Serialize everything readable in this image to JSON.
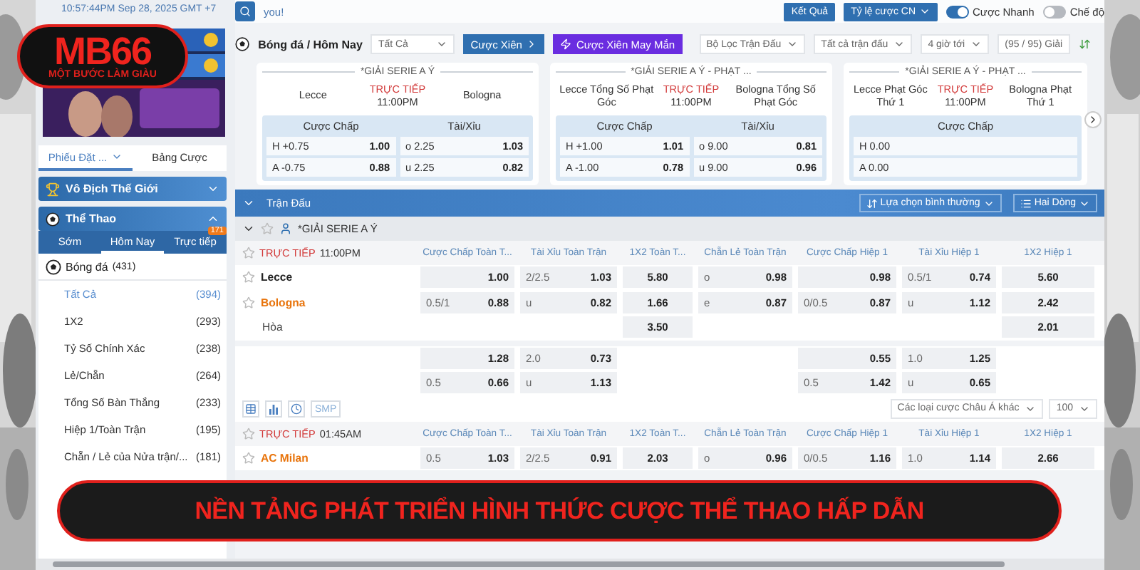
{
  "overlay": {
    "logo": {
      "title": "MB66",
      "slogan": "MỘT BƯỚC LÀM GIÀU"
    },
    "banner": "NỀN TẢNG PHÁT TRIỂN HÌNH THỨC CƯỢC THỂ THAO HẤP DẪN"
  },
  "top_bar": {
    "clock": "10:57:44PM Sep 28, 2025 GMT +7",
    "search_value": "you!",
    "buttons": [
      {
        "label": "Kết Quả",
        "kind": "button"
      },
      {
        "label": "Tỷ lệ cược CN",
        "kind": "dropdown"
      }
    ],
    "toggles": [
      {
        "label": "Cược Nhanh",
        "on": true
      },
      {
        "label": "Chế độ",
        "on": false
      }
    ]
  },
  "sidebar": {
    "tabs": [
      {
        "label": "Phiếu Đặt ...",
        "selected": true
      },
      {
        "label": "Bảng Cược",
        "selected": false
      }
    ],
    "sections": [
      {
        "title": "Vô Địch Thế Giới",
        "kind": "trophy",
        "expanded": false
      },
      {
        "title": "Thể Thao",
        "kind": "sports",
        "expanded": true
      }
    ],
    "sport_tabs": [
      {
        "label": "Sớm",
        "selected": false
      },
      {
        "label": "Hôm Nay",
        "selected": true
      },
      {
        "label": "Trực tiếp",
        "selected": false,
        "badge": "171"
      }
    ],
    "sport": {
      "label": "Bóng đá",
      "count": "(431)"
    },
    "markets": [
      {
        "label": "Tất Cả",
        "count": "(394)",
        "selected": true
      },
      {
        "label": "1X2",
        "count": "(293)",
        "selected": false
      },
      {
        "label": "Tỷ Số Chính Xác",
        "count": "(238)",
        "selected": false
      },
      {
        "label": "Lẻ/Chẵn",
        "count": "(264)",
        "selected": false
      },
      {
        "label": "Tổng Số Bàn Thắng",
        "count": "(233)",
        "selected": false
      },
      {
        "label": "Hiệp 1/Toàn Trận",
        "count": "(195)",
        "selected": false
      },
      {
        "label": "Chẵn / Lẻ của Nửa trận/...",
        "count": "(181)",
        "selected": false
      }
    ]
  },
  "filter_bar": {
    "breadcrumb": "Bóng đá / Hôm Nay",
    "select": "Tất Cả",
    "buttons": [
      {
        "label": "Cược Xiên",
        "kind": "parlay"
      },
      {
        "label": "Cược Xiên May Mắn",
        "kind": "lucky"
      }
    ],
    "filters": [
      {
        "label": "Bộ Lọc Trận Đấu",
        "kind": "dropdown"
      },
      {
        "label": "Tất cả trận đấu",
        "kind": "dropdown"
      },
      {
        "label": "4 giờ tới",
        "kind": "dropdown"
      },
      {
        "label": "(95 / 95) Giải",
        "kind": "text"
      }
    ]
  },
  "featured": [
    {
      "league": "*GIẢI SERIE A Ý",
      "home": "Lecce",
      "status": "TRỰC TIẾP",
      "time": "11:00PM",
      "away": "Bologna",
      "markets": [
        {
          "title": "Cược Chấp",
          "rows": [
            {
              "label": "H +0.75",
              "odds": "1.00"
            },
            {
              "label": "A -0.75",
              "odds": "0.88"
            }
          ]
        },
        {
          "title": "Tài/Xỉu",
          "rows": [
            {
              "label": "o 2.25",
              "odds": "1.03"
            },
            {
              "label": "u 2.25",
              "odds": "0.82"
            }
          ]
        }
      ]
    },
    {
      "league": "*GIẢI SERIE A Ý - PHẠT ...",
      "home": "Lecce Tổng Số Phạt Góc",
      "status": "TRỰC TIẾP",
      "time": "11:00PM",
      "away": "Bologna Tổng Số Phạt Góc",
      "markets": [
        {
          "title": "Cược Chấp",
          "rows": [
            {
              "label": "H +1.00",
              "odds": "1.01"
            },
            {
              "label": "A -1.00",
              "odds": "0.78"
            }
          ]
        },
        {
          "title": "Tài/Xỉu",
          "rows": [
            {
              "label": "o 9.00",
              "odds": "0.81"
            },
            {
              "label": "u 9.00",
              "odds": "0.96"
            }
          ]
        }
      ]
    },
    {
      "league": "*GIẢI SERIE A Ý - PHẠT ...",
      "home": "Lecce Phạt Góc Thứ 1",
      "status": "TRỰC TIẾP",
      "time": "11:00PM",
      "away": "Bologna Phạt Thứ 1",
      "markets": [
        {
          "title": "Cược Chấp",
          "rows": [
            {
              "label": "H 0.00"
            },
            {
              "label": "A 0.00"
            }
          ]
        }
      ]
    }
  ],
  "matches_panel": {
    "title": "Trận Đấu",
    "options": [
      {
        "label": "Lựa chọn bình thường",
        "kind": "sort"
      },
      {
        "label": "Hai Dòng",
        "kind": "lines"
      }
    ],
    "league": "*GIẢI SERIE A Ý",
    "matches": [
      {
        "status": "TRỰC TIẾP",
        "time": "11:00PM",
        "columns": [
          {
            "label": "Cược Chấp Toàn T...",
            "kind": "pair"
          },
          {
            "label": "Tài Xỉu Toàn Trận",
            "kind": "pair"
          },
          {
            "label": "1X2 Toàn T...",
            "kind": "single"
          },
          {
            "label": "Chẵn Lẻ Toàn Trận",
            "kind": "pair"
          },
          {
            "label": "Cược Chấp Hiệp 1",
            "kind": "pair"
          },
          {
            "label": "Tài Xỉu Hiệp 1",
            "kind": "pair"
          },
          {
            "label": "1X2 Hiệp 1",
            "kind": "single"
          }
        ],
        "rows": [
          {
            "team": "Lecce",
            "kind": "home",
            "cells": [
              {
                "odds": "1.00"
              },
              {
                "line": "2/2.5",
                "odds": "1.03"
              },
              {
                "odds": "5.80"
              },
              {
                "line": "o",
                "odds": "0.98"
              },
              {
                "odds": "0.98"
              },
              {
                "line": "0.5/1",
                "odds": "0.74"
              },
              {
                "odds": "5.60"
              }
            ]
          },
          {
            "team": "Bologna",
            "kind": "away",
            "cells": [
              {
                "line": "0.5/1",
                "odds": "0.88"
              },
              {
                "line": "u",
                "odds": "0.82"
              },
              {
                "odds": "1.66"
              },
              {
                "line": "e",
                "odds": "0.87"
              },
              {
                "line": "0/0.5",
                "odds": "0.87"
              },
              {
                "line": "u",
                "odds": "1.12"
              },
              {
                "odds": "2.42"
              }
            ]
          },
          {
            "team": "Hòa",
            "kind": "draw",
            "cells": [
              null,
              null,
              {
                "odds": "3.50"
              },
              null,
              null,
              null,
              {
                "odds": "2.01"
              }
            ]
          },
          {
            "kind": "extra",
            "cells": [
              {
                "odds": "1.28"
              },
              {
                "line": "2.0",
                "odds": "0.73"
              },
              null,
              null,
              {
                "odds": "0.55"
              },
              {
                "line": "1.0",
                "odds": "1.25"
              },
              null
            ]
          },
          {
            "kind": "extra",
            "cells": [
              {
                "line": "0.5",
                "odds": "0.66"
              },
              {
                "line": "u",
                "odds": "1.13"
              },
              null,
              null,
              {
                "line": "0.5",
                "odds": "1.42"
              },
              {
                "line": "u",
                "odds": "0.65"
              },
              null
            ]
          }
        ],
        "tools": {
          "label": "SMP",
          "selects": [
            "Các loại cược Châu Á khác",
            "100"
          ]
        }
      },
      {
        "status": "TRỰC TIẾP",
        "time": "01:45AM",
        "columns": [
          {
            "label": "Cược Chấp Toàn T...",
            "kind": "pair"
          },
          {
            "label": "Tài Xỉu Toàn Trận",
            "kind": "pair"
          },
          {
            "label": "1X2 Toàn T...",
            "kind": "single"
          },
          {
            "label": "Chẵn Lẻ Toàn Trận",
            "kind": "pair"
          },
          {
            "label": "Cược Chấp Hiệp 1",
            "kind": "pair"
          },
          {
            "label": "Tài Xỉu Hiệp 1",
            "kind": "pair"
          },
          {
            "label": "1X2 Hiệp 1",
            "kind": "single"
          }
        ],
        "rows": [
          {
            "team": "AC Milan",
            "kind": "away",
            "cells": [
              {
                "line": "0.5",
                "odds": "1.03"
              },
              {
                "line": "2/2.5",
                "odds": "0.91"
              },
              {
                "odds": "2.03"
              },
              {
                "line": "o",
                "odds": "0.96"
              },
              {
                "line": "0/0.5",
                "odds": "1.16"
              },
              {
                "line": "1.0",
                "odds": "1.14"
              },
              {
                "odds": "2.66"
              }
            ]
          }
        ]
      }
    ]
  }
}
